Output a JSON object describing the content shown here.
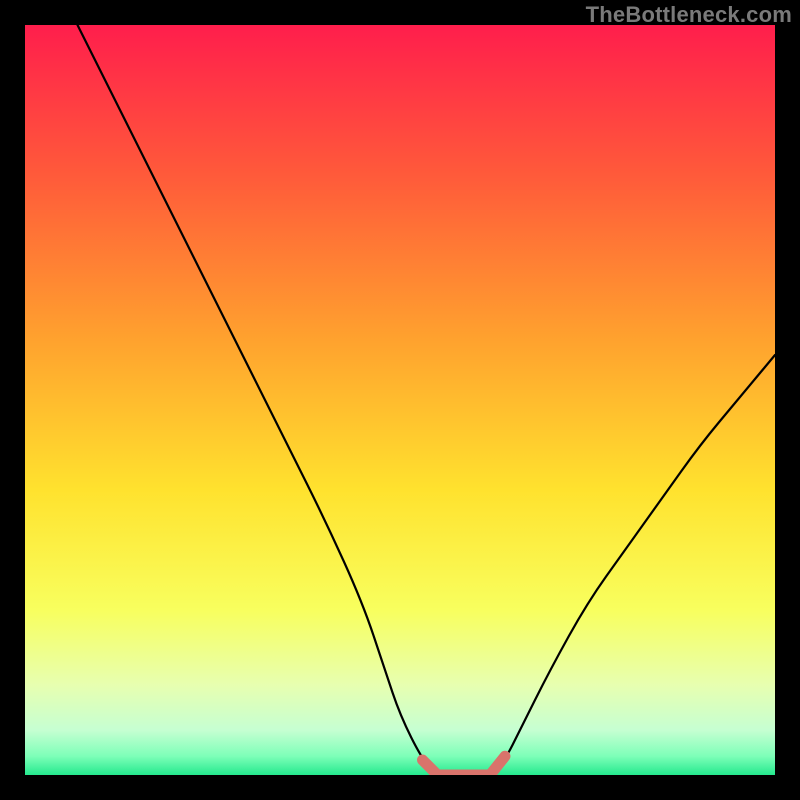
{
  "watermark": "TheBottleneck.com",
  "colors": {
    "frame": "#000000",
    "curve": "#000000",
    "bottom_marker": "#d9736b",
    "gradient_stops": [
      {
        "offset": 0.0,
        "color": "#ff1e4c"
      },
      {
        "offset": 0.2,
        "color": "#ff5a3a"
      },
      {
        "offset": 0.42,
        "color": "#ffa22e"
      },
      {
        "offset": 0.62,
        "color": "#ffe22e"
      },
      {
        "offset": 0.78,
        "color": "#f8ff5e"
      },
      {
        "offset": 0.88,
        "color": "#e7ffb0"
      },
      {
        "offset": 0.94,
        "color": "#c6ffd2"
      },
      {
        "offset": 0.975,
        "color": "#7dffb8"
      },
      {
        "offset": 1.0,
        "color": "#25e98e"
      }
    ]
  },
  "chart_data": {
    "type": "line",
    "title": "",
    "xlabel": "",
    "ylabel": "",
    "xlim": [
      0,
      100
    ],
    "ylim": [
      0,
      100
    ],
    "series": [
      {
        "name": "bottleneck-curve",
        "x": [
          7,
          10,
          15,
          20,
          25,
          30,
          35,
          40,
          45,
          48,
          50,
          53,
          55,
          57,
          60,
          62,
          64,
          66,
          70,
          75,
          80,
          85,
          90,
          95,
          100
        ],
        "y": [
          100,
          94,
          84,
          74,
          64,
          54,
          44,
          34,
          23,
          14,
          8,
          2,
          0,
          0,
          0,
          0,
          2,
          6,
          14,
          23,
          30,
          37,
          44,
          50,
          56
        ]
      }
    ],
    "highlight_range_x": [
      53,
      64
    ]
  }
}
